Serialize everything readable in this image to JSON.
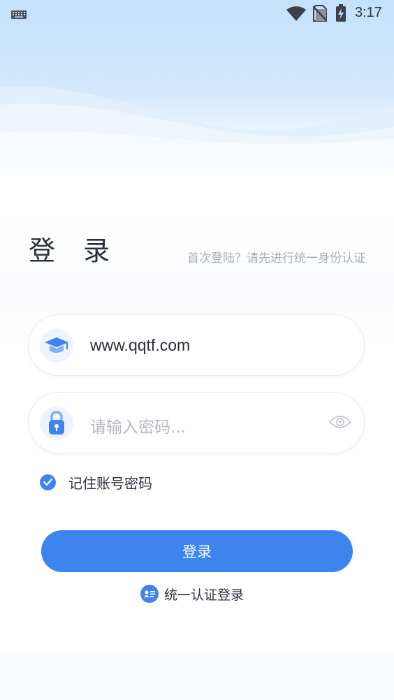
{
  "status_bar": {
    "time": "3:17"
  },
  "login": {
    "title": "登 录",
    "first_login_hint": "首次登陆？请先进行统一身份认证",
    "username_value": "www.qqtf.com",
    "password_placeholder": "请输入密码...",
    "remember_label": "记住账号密码",
    "remember_checked": true,
    "submit_label": "登录",
    "unified_login_label": "统一认证登录"
  },
  "colors": {
    "accent": "#3d84ee",
    "header_blue": "#c5e1fb",
    "text_primary": "#2b3038",
    "text_hint": "#a9adb5"
  },
  "icons": {
    "keyboard": "keyboard-icon",
    "wifi": "wifi-icon",
    "no_sim": "no-sim-icon",
    "battery": "battery-charging-icon",
    "user": "graduation-cap-icon",
    "password": "lock-icon",
    "visibility": "eye-icon",
    "checkbox": "check-icon",
    "unified": "id-card-icon"
  }
}
